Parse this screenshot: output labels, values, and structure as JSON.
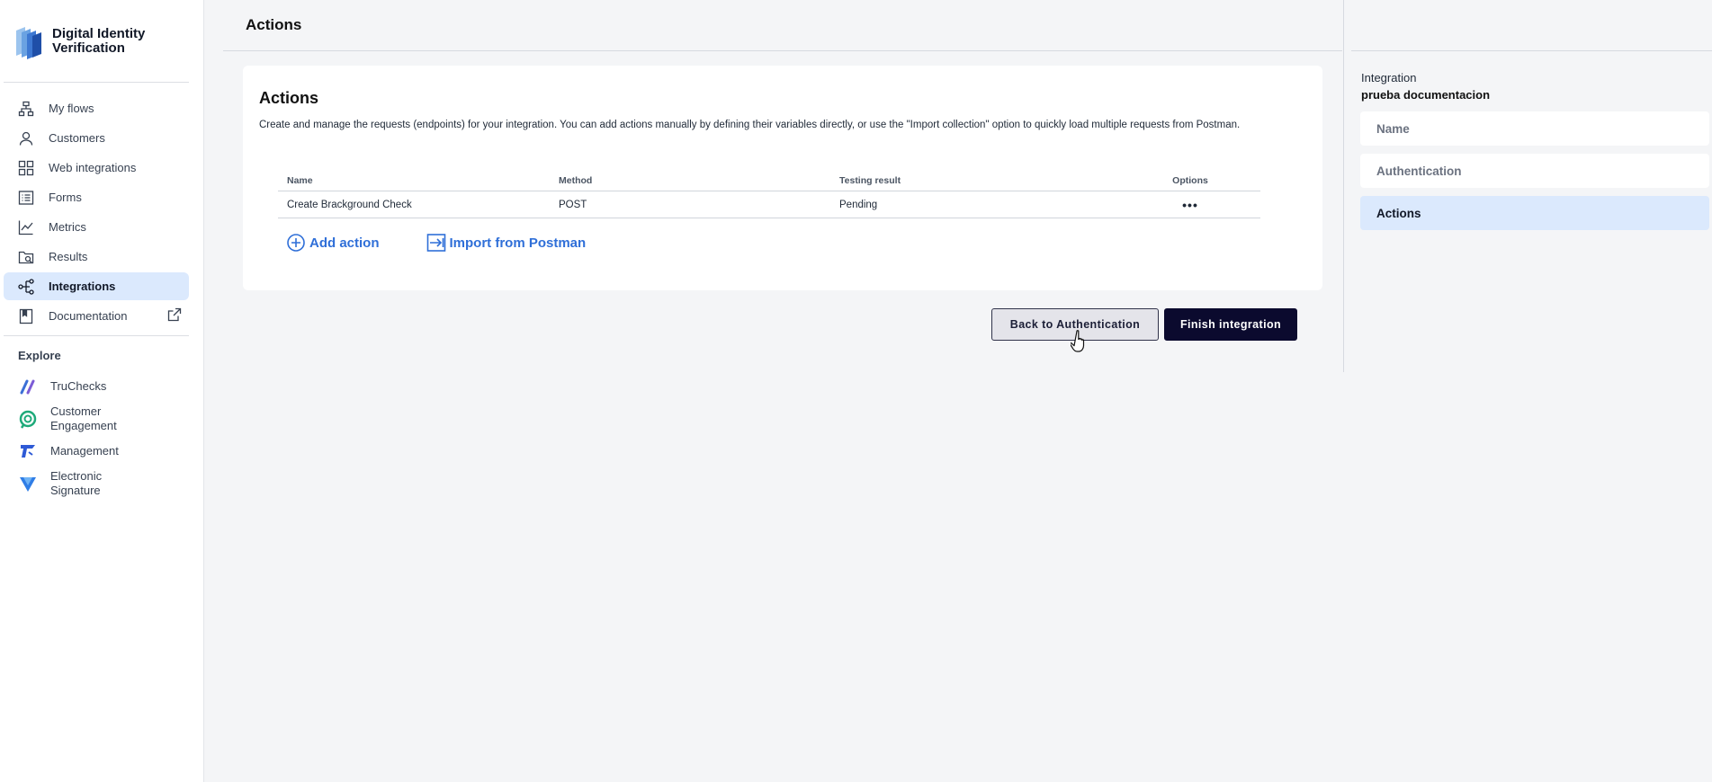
{
  "brand": {
    "line1": "Digital Identity",
    "line2": "Verification"
  },
  "nav": {
    "items": [
      {
        "label": "My flows",
        "icon": "flow-icon"
      },
      {
        "label": "Customers",
        "icon": "user-icon"
      },
      {
        "label": "Web integrations",
        "icon": "grid-icon"
      },
      {
        "label": "Forms",
        "icon": "form-icon"
      },
      {
        "label": "Metrics",
        "icon": "chart-icon"
      },
      {
        "label": "Results",
        "icon": "folder-search-icon"
      },
      {
        "label": "Integrations",
        "icon": "integrations-icon",
        "active": true
      },
      {
        "label": "Documentation",
        "icon": "book-icon",
        "external": true
      }
    ]
  },
  "explore": {
    "title": "Explore",
    "items": [
      {
        "label": "TruChecks",
        "icon": "truchecks-icon"
      },
      {
        "label_line1": "Customer",
        "label_line2": "Engagement",
        "icon": "customer-engagement-icon"
      },
      {
        "label": "Management",
        "icon": "management-icon"
      },
      {
        "label_line1": "Electronic",
        "label_line2": "Signature",
        "icon": "electronic-signature-icon"
      }
    ]
  },
  "header": {
    "title": "Actions"
  },
  "card": {
    "title": "Actions",
    "description": "Create and manage the requests (endpoints) for your integration. You can add actions manually by defining their variables directly, or use the \"Import collection\" option to quickly load multiple requests from Postman."
  },
  "table": {
    "columns": {
      "name": "Name",
      "method": "Method",
      "testing": "Testing result",
      "options": "Options"
    },
    "rows": [
      {
        "name": "Create Brackground Check",
        "method": "POST",
        "testing": "Pending",
        "options": "•••"
      }
    ]
  },
  "links": {
    "add_action": "Add action",
    "import_postman": "Import from Postman"
  },
  "buttons": {
    "back": "Back to Authentication",
    "finish": "Finish integration"
  },
  "right_panel": {
    "integration_label": "Integration",
    "integration_name": "prueba documentacion",
    "steps": [
      {
        "label": "Name",
        "active": false
      },
      {
        "label": "Authentication",
        "active": false
      },
      {
        "label": "Actions",
        "active": true
      }
    ]
  },
  "colors": {
    "accent": "#2f6fd8",
    "active_bg": "#dbe9fd",
    "primary_button": "#0b0a2e",
    "background": "#f4f5f7"
  }
}
